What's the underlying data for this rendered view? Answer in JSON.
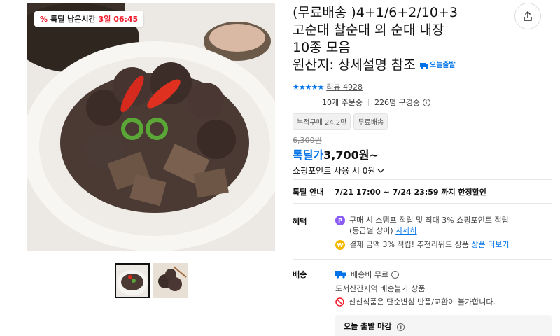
{
  "badge": {
    "prefix": "특딜 남은시간",
    "time": "3일 06:45"
  },
  "title": {
    "lines": [
      "(무료배송 )4+1/6+2/10+3",
      "고순대 찰순대 외 순대 내장",
      "10종 모음",
      "원산지: 상세설명 참조"
    ],
    "delivery_tag": "오늘출발"
  },
  "rating": {
    "stars": 5,
    "review_label": "리뷰 4928"
  },
  "stats": {
    "orders": "10개 주문중",
    "subscribers": "226명 구경중"
  },
  "chips": [
    "누적구매 24.2만",
    "무료배송"
  ],
  "price": {
    "original": "6,300원",
    "deal_label": "톡딜가",
    "deal_price": "3,700원~",
    "points": "쇼핑포인트 사용 시 0원"
  },
  "deal_info": {
    "label": "톡딜 안내",
    "period": "7/21 17:00 ~ 7/24 23:59 까지 한정할인"
  },
  "benefits": {
    "label": "혜택",
    "line1": "구매 시 스탬프 적립 및 최대 3% 쇼핑포인트 적립",
    "line1_cont": "(등급별 상이)",
    "line1_link": "자세히",
    "line2": "결제 금액 3% 적립! 추천리워드 상품",
    "line2_link": "상품 더보기"
  },
  "shipping": {
    "label": "배송",
    "fee": "배송비 무료",
    "region": "도서산간지역 배송불가 상품",
    "fresh": "신선식품은 단순변심 반품/교환이 불가합니다.",
    "deadline": "오늘 출발 마감"
  },
  "colors": {
    "accent": "#0073e9",
    "alert": "#f01c2c"
  }
}
